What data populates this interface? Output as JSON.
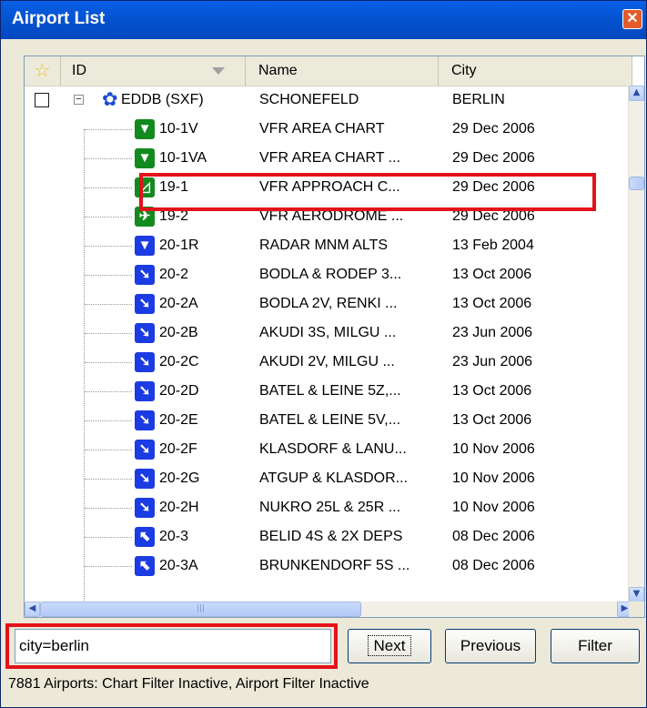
{
  "window": {
    "title": "Airport List",
    "close_glyph": "✕"
  },
  "columns": {
    "star": "☆",
    "id": "ID",
    "name": "Name",
    "city": "City"
  },
  "root_row": {
    "id": "EDDB (SXF)",
    "name": "SCHONEFELD",
    "city": "BERLIN",
    "icon": "gear-icon",
    "expander": "−"
  },
  "rows": [
    {
      "icon": "tower-icon",
      "color": "green",
      "glyph": "▼",
      "id": "10-1V",
      "name": "VFR AREA CHART",
      "city": "29 Dec 2006"
    },
    {
      "icon": "tower-icon",
      "color": "green",
      "glyph": "▼",
      "id": "10-1VA",
      "name": "VFR AREA CHART ...",
      "city": "29 Dec 2006"
    },
    {
      "icon": "approach-icon",
      "color": "green",
      "glyph": "◿",
      "id": "19-1",
      "name": "VFR APPROACH C...",
      "city": "29 Dec 2006"
    },
    {
      "icon": "aerodrome-icon",
      "color": "green",
      "glyph": "✈",
      "id": "19-2",
      "name": "VFR AERODROME ...",
      "city": "29 Dec 2006"
    },
    {
      "icon": "radar-icon",
      "color": "blue",
      "glyph": "▼",
      "id": "20-1R",
      "name": "RADAR MNM ALTS",
      "city": "13 Feb 2004"
    },
    {
      "icon": "arrival-icon",
      "color": "blue",
      "glyph": "➘",
      "id": "20-2",
      "name": "BODLA & RODEP 3...",
      "city": "13 Oct 2006"
    },
    {
      "icon": "arrival-icon",
      "color": "blue",
      "glyph": "➘",
      "id": "20-2A",
      "name": "BODLA 2V, RENKI ...",
      "city": "13 Oct 2006"
    },
    {
      "icon": "arrival-icon",
      "color": "blue",
      "glyph": "➘",
      "id": "20-2B",
      "name": "AKUDI 3S, MILGU ...",
      "city": "23 Jun 2006"
    },
    {
      "icon": "arrival-icon",
      "color": "blue",
      "glyph": "➘",
      "id": "20-2C",
      "name": "AKUDI 2V, MILGU ...",
      "city": "23 Jun 2006"
    },
    {
      "icon": "arrival-icon",
      "color": "blue",
      "glyph": "➘",
      "id": "20-2D",
      "name": "BATEL & LEINE 5Z,...",
      "city": "13 Oct 2006"
    },
    {
      "icon": "arrival-icon",
      "color": "blue",
      "glyph": "➘",
      "id": "20-2E",
      "name": "BATEL & LEINE 5V,...",
      "city": "13 Oct 2006"
    },
    {
      "icon": "arrival-icon",
      "color": "blue",
      "glyph": "➘",
      "id": "20-2F",
      "name": "KLASDORF & LANU...",
      "city": "10 Nov 2006"
    },
    {
      "icon": "arrival-icon",
      "color": "blue",
      "glyph": "➘",
      "id": "20-2G",
      "name": "ATGUP & KLASDOR...",
      "city": "10 Nov 2006"
    },
    {
      "icon": "arrival-icon",
      "color": "blue",
      "glyph": "➘",
      "id": "20-2H",
      "name": "NUKRO 25L & 25R ...",
      "city": "10 Nov 2006"
    },
    {
      "icon": "departure-icon",
      "color": "blue",
      "glyph": "⬉",
      "id": "20-3",
      "name": "BELID 4S & 2X DEPS",
      "city": "08 Dec 2006"
    },
    {
      "icon": "departure-icon",
      "color": "blue",
      "glyph": "⬉",
      "id": "20-3A",
      "name": "BRUNKENDORF 5S ...",
      "city": "08 Dec 2006"
    }
  ],
  "search": {
    "value": "city=berlin"
  },
  "buttons": {
    "next": "Next",
    "previous": "Previous",
    "filter": "Filter"
  },
  "status": "7881 Airports: Chart Filter Inactive, Airport Filter Inactive",
  "scroll": {
    "up": "▲",
    "down": "▼",
    "left": "◀",
    "right": "▶",
    "grip": "|||"
  }
}
